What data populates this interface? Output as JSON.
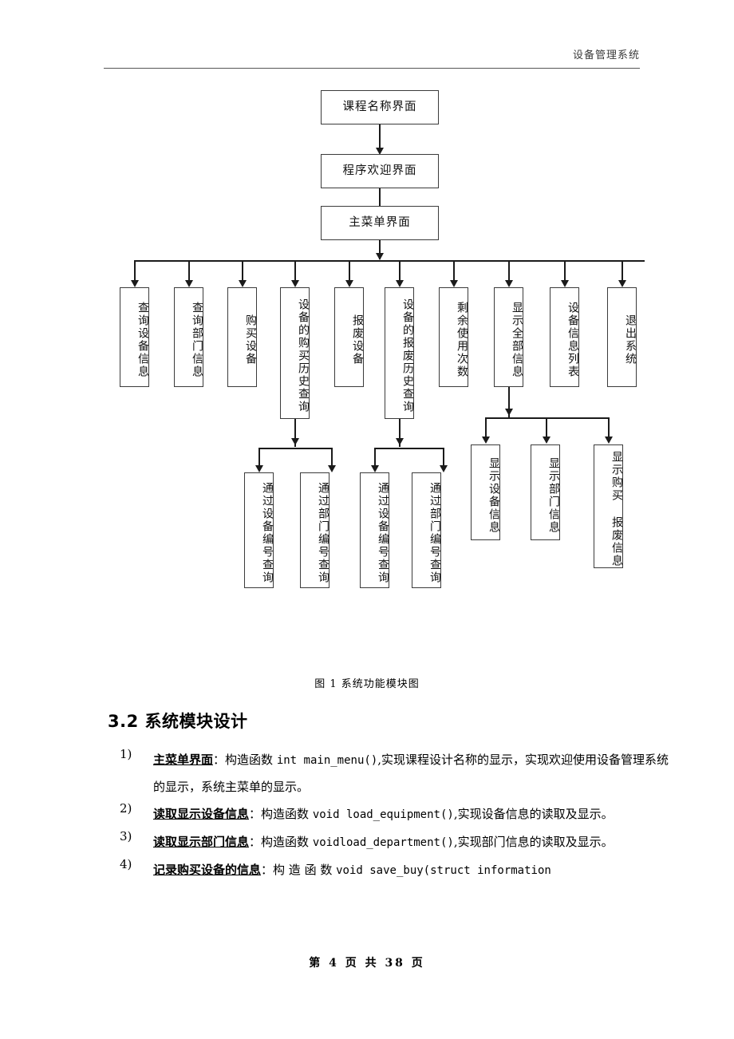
{
  "header": {
    "title": "设备管理系统"
  },
  "figure": {
    "caption": "图 1 系统功能模块图",
    "top_nodes": [
      {
        "label": "课程名称界面"
      },
      {
        "label": "程序欢迎界面"
      },
      {
        "label": "主菜单界面"
      }
    ],
    "menu_nodes": [
      {
        "label": "查询设备信息"
      },
      {
        "label": "查询部门信息"
      },
      {
        "label": "购买设备"
      },
      {
        "label": "设备的购买历史查询"
      },
      {
        "label": "报废设备"
      },
      {
        "label": "设备的报废历史查询"
      },
      {
        "label": "剩余使用次数"
      },
      {
        "label": "显示全部信息"
      },
      {
        "label": "设备信息列表"
      },
      {
        "label": "退出系统"
      }
    ],
    "buy_history_children": [
      {
        "label": "通过设备编号查询"
      },
      {
        "label": "通过部门编号查询"
      }
    ],
    "scrap_history_children": [
      {
        "label": "通过设备编号查询"
      },
      {
        "label": "通过部门编号查询"
      }
    ],
    "show_all_children": [
      {
        "label": "显示设备信息"
      },
      {
        "label": "显示部门信息"
      },
      {
        "label": "显示购买 报废信息"
      }
    ]
  },
  "section": {
    "heading": "3.2 系统模块设计",
    "items": [
      {
        "num": "1)",
        "term": "主菜单界面",
        "colon": "：",
        "desc_a": "构造函数 ",
        "code": "int main_menu()",
        "desc_b": ",实现课程设计名称的显示，实现欢迎使用设备管理系统的显示，系统主菜单的显示。"
      },
      {
        "num": "2)",
        "term": "读取显示设备信息",
        "colon": "：",
        "desc_a": "构造函数 ",
        "code": "void load_equipment()",
        "desc_b": ",实现设备信息的读取及显示。"
      },
      {
        "num": "3)",
        "term": "读取显示部门信息",
        "colon": "：",
        "desc_a": "构造函数 ",
        "code": "voidload_department()",
        "desc_b": ",实现部门信息的读取及显示。"
      },
      {
        "num": "4)",
        "term": "记录购买设备的信息",
        "colon": "：",
        "desc_a": "构 造 函 数 ",
        "code": "void save_buy(struct information",
        "desc_b": ""
      }
    ]
  },
  "footer": {
    "text": "第 4 页 共 38 页"
  }
}
